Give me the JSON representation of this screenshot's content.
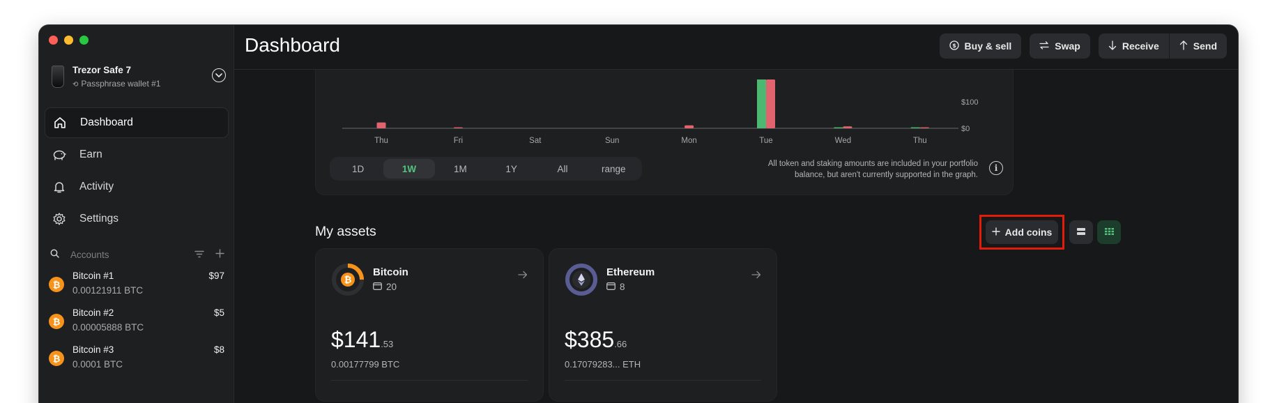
{
  "page": {
    "title": "Dashboard"
  },
  "device": {
    "name": "Trezor Safe 7",
    "wallet": "Passphrase wallet #1"
  },
  "nav": [
    {
      "label": "Dashboard",
      "icon": "home-icon",
      "active": true
    },
    {
      "label": "Earn",
      "icon": "piggy-bank-icon"
    },
    {
      "label": "Activity",
      "icon": "bell-icon"
    },
    {
      "label": "Settings",
      "icon": "gear-icon"
    }
  ],
  "accounts": {
    "label": "Accounts",
    "items": [
      {
        "name": "Bitcoin #1",
        "fiat": "$97",
        "crypto": "0.00121911 BTC",
        "icon": "bitcoin-icon"
      },
      {
        "name": "Bitcoin #2",
        "fiat": "$5",
        "crypto": "0.00005888 BTC",
        "icon": "bitcoin-icon"
      },
      {
        "name": "Bitcoin #3",
        "fiat": "$8",
        "crypto": "0.0001 BTC",
        "icon": "bitcoin-icon"
      }
    ]
  },
  "actions": {
    "buy_sell": "Buy & sell",
    "swap": "Swap",
    "receive": "Receive",
    "send": "Send"
  },
  "chart_data": {
    "type": "bar",
    "categories": [
      "Thu",
      "Fri",
      "Sat",
      "Sun",
      "Mon",
      "Tue",
      "Wed",
      "Thu"
    ],
    "y_tick_labels": [
      "$0",
      "$100"
    ],
    "series": [
      {
        "color": "#4cb871",
        "values": [
          0,
          0,
          0,
          0,
          0,
          100,
          2,
          2
        ]
      },
      {
        "color": "#e0636d",
        "values": [
          12,
          2,
          0,
          0,
          6,
          100,
          4,
          2
        ]
      }
    ],
    "ylim": [
      0,
      100
    ]
  },
  "range": {
    "options": [
      "1D",
      "1W",
      "1M",
      "1Y",
      "All",
      "range"
    ],
    "selected": "1W"
  },
  "chart_note": {
    "line1": "All token and staking amounts are included in your portfolio",
    "line2": "balance, but aren't currently supported in the graph."
  },
  "assets": {
    "title": "My assets",
    "add_coins": "Add coins",
    "cards": [
      {
        "name": "Bitcoin",
        "count": "20",
        "fiat_main": "$141",
        "fiat_cents": ".53",
        "crypto": "0.00177799 BTC",
        "color": "#f7931a",
        "icon": "bitcoin-icon"
      },
      {
        "name": "Ethereum",
        "count": "8",
        "fiat_main": "$385",
        "fiat_cents": ".66",
        "crypto": "0.17079283... ETH",
        "color": "#6b6fa8",
        "icon": "ethereum-icon"
      }
    ]
  },
  "colors": {
    "accent_green": "#52c480",
    "highlight_red": "#e31c0a",
    "bitcoin_orange": "#f7931a",
    "background": "#17181a"
  }
}
